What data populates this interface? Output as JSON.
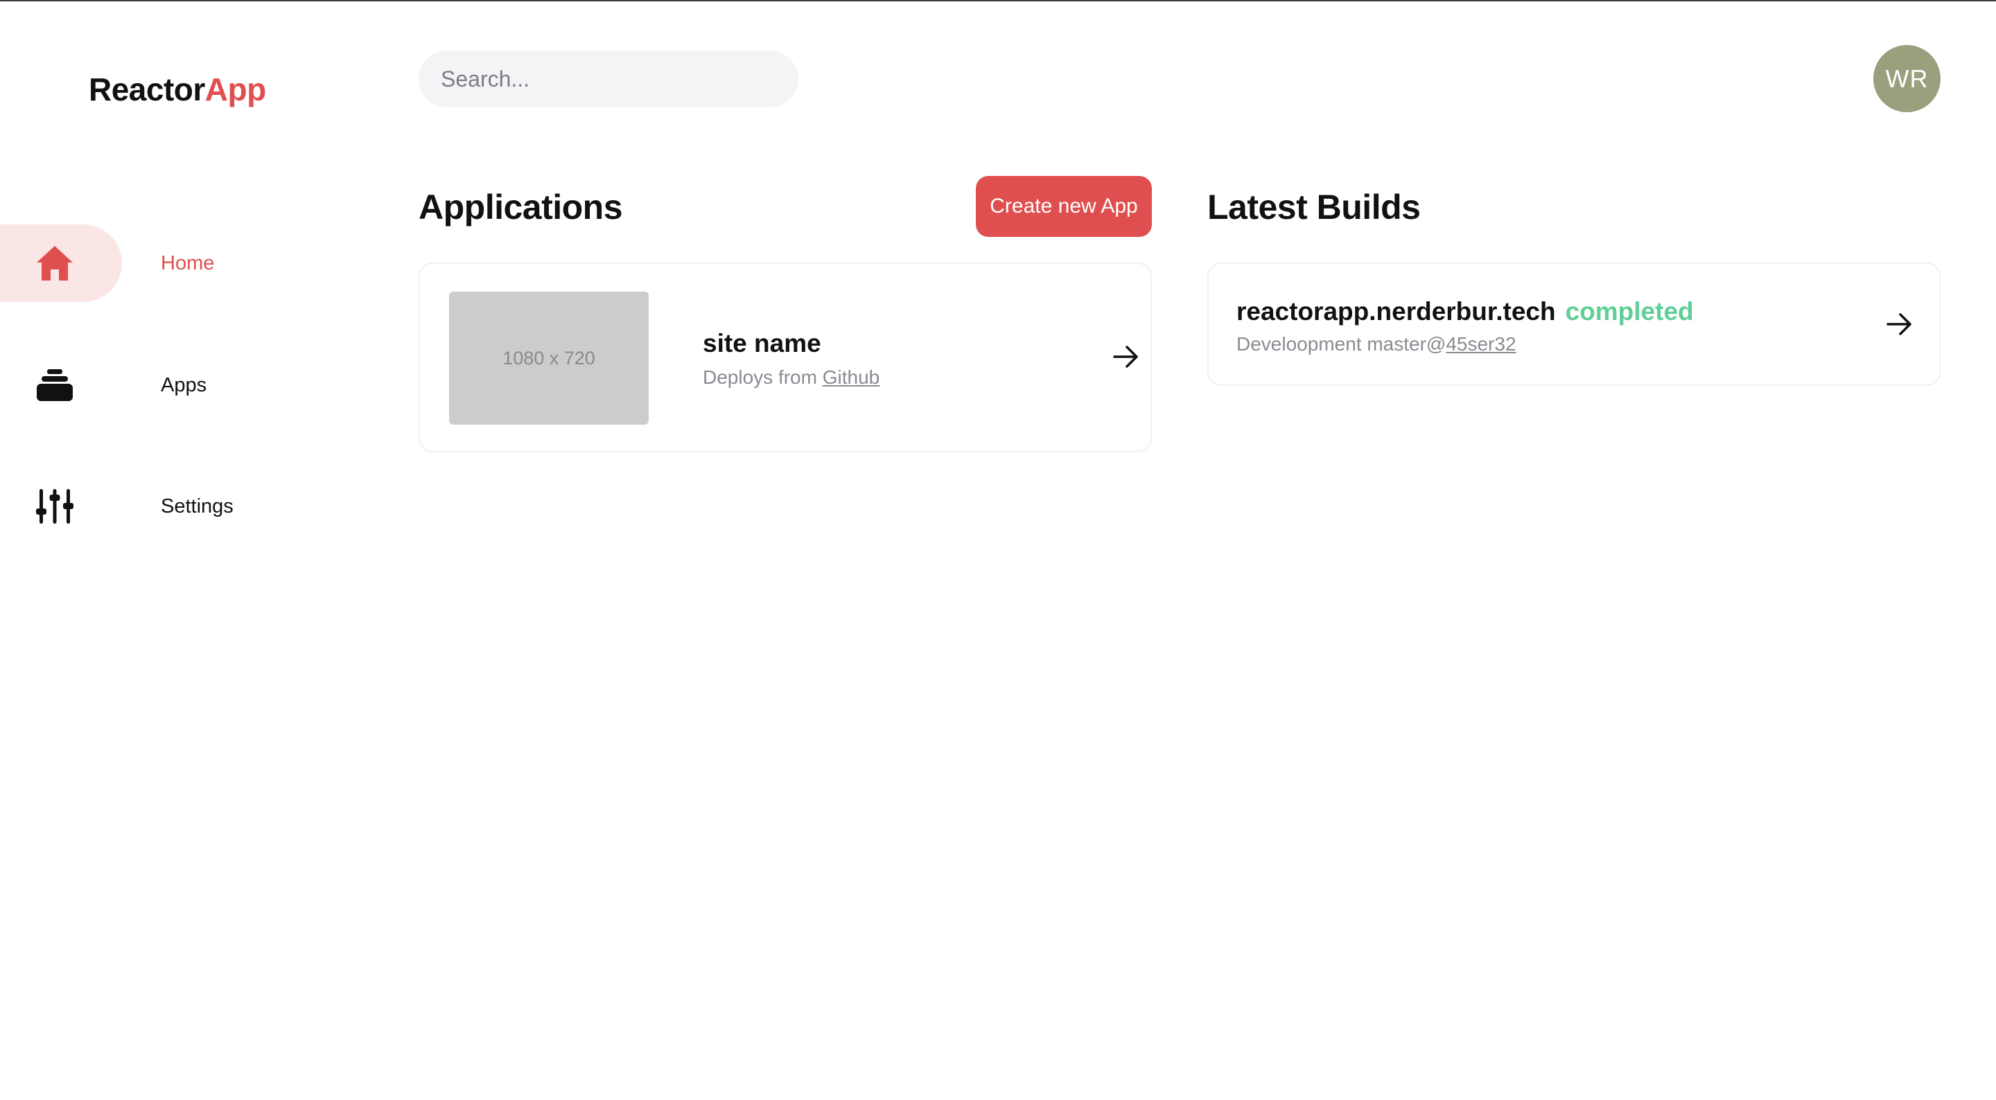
{
  "brand": {
    "name_primary": "Reactor",
    "name_accent": "App",
    "accent_color": "#e04f4f"
  },
  "search": {
    "placeholder": "Search...",
    "value": ""
  },
  "user": {
    "initials": "WR",
    "avatar_color": "#99a07d"
  },
  "sidebar": {
    "items": [
      {
        "label": "Home",
        "icon": "home-icon",
        "active": true
      },
      {
        "label": "Apps",
        "icon": "stack-icon",
        "active": false
      },
      {
        "label": "Settings",
        "icon": "sliders-icon",
        "active": false
      }
    ]
  },
  "applications": {
    "title": "Applications",
    "create_label": "Create new App",
    "items": [
      {
        "thumbnail_text": "1080 x 720",
        "name": "site name",
        "deploys_prefix": "Deploys from ",
        "source": "Github"
      }
    ]
  },
  "builds": {
    "title": "Latest Builds",
    "items": [
      {
        "host": "reactorapp.nerderbur.tech",
        "status": "completed",
        "status_color": "#5fcf95",
        "detail_prefix": "Develoopment master@",
        "commit": "45ser32"
      }
    ]
  }
}
